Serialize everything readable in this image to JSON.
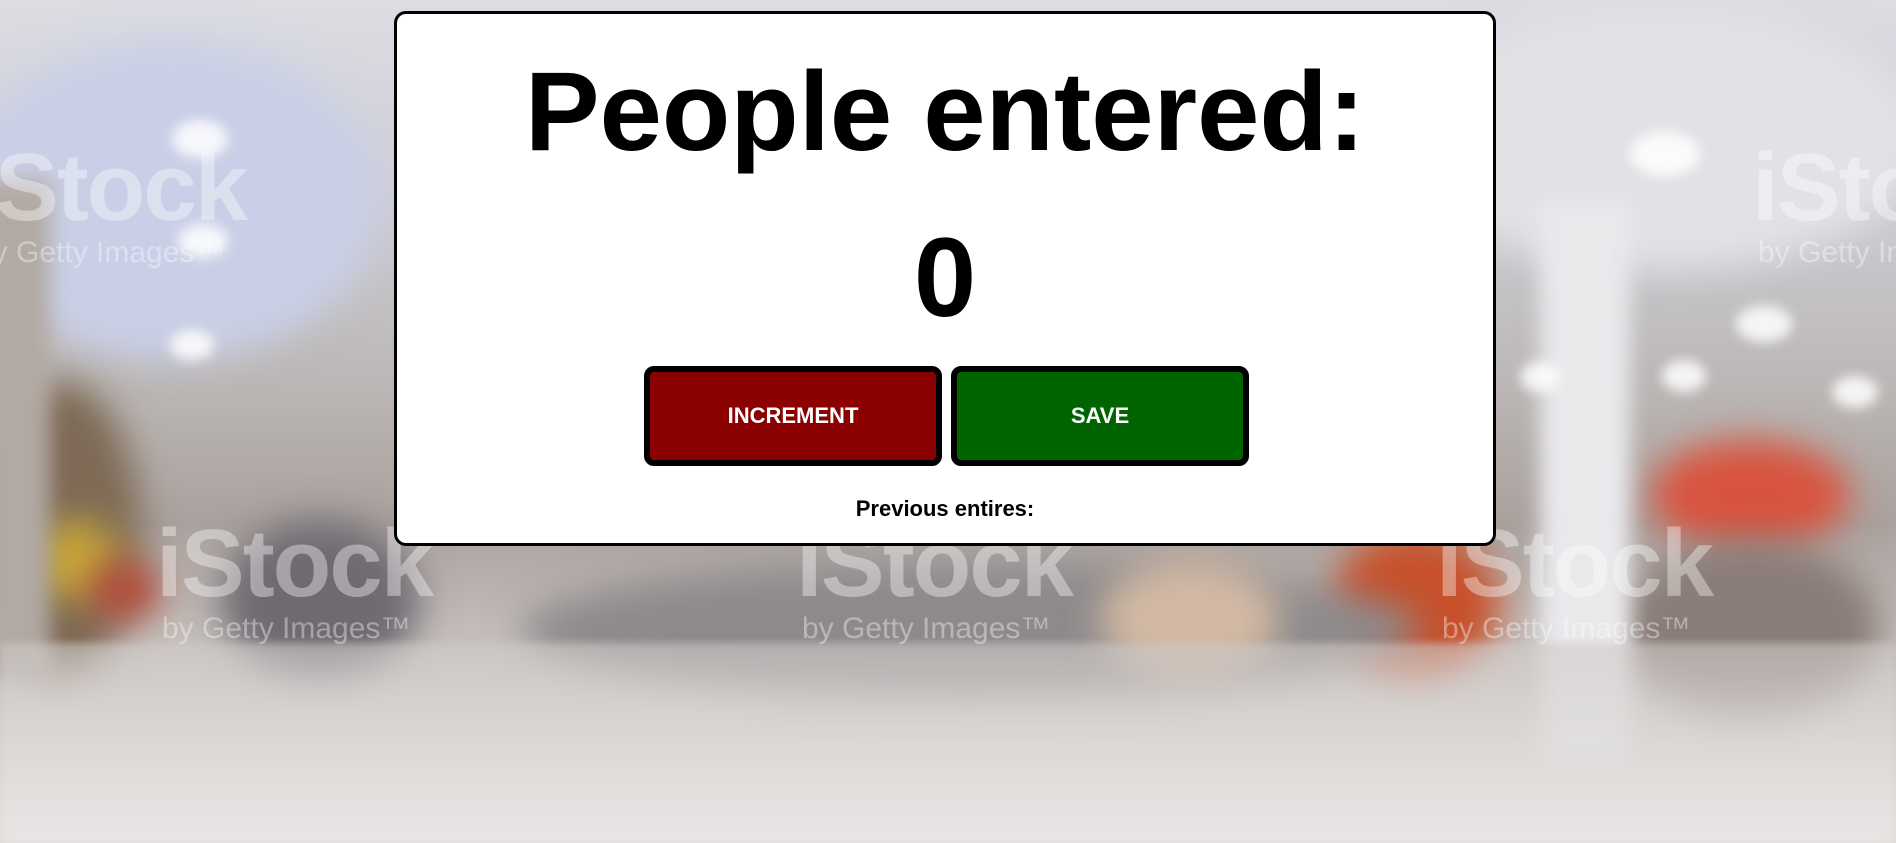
{
  "counter": {
    "heading": "People entered:",
    "count": "0",
    "increment_label": "INCREMENT",
    "save_label": "SAVE",
    "previous_entries_label": "Previous entires:",
    "colors": {
      "increment_bg": "#8b0000",
      "save_bg": "#006400",
      "panel_bg": "#ffffff"
    }
  },
  "background": {
    "watermark_brand": "iStock",
    "watermark_tagline": "by Getty Images™"
  }
}
